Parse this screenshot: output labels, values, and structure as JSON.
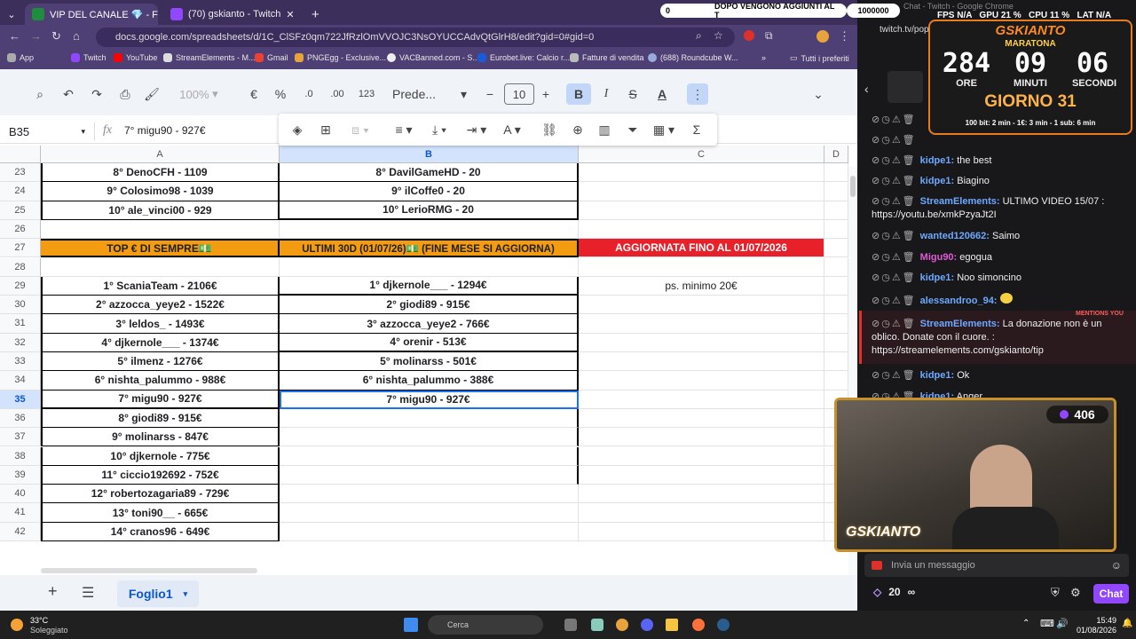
{
  "browser": {
    "tabs": [
      {
        "label": "VIP DEL CANALE 💎 - Fogli Go",
        "active": true,
        "color": "#1e8e3e"
      },
      {
        "label": "(70) gskianto - Twitch",
        "active": false,
        "color": "#9146ff"
      }
    ],
    "new_tab": "+",
    "url": "docs.google.com/spreadsheets/d/1C_ClSFz0qm722JfRzlOmVVOJC3NsOYUCCAdvQtGlrH8/edit?gid=0#gid=0",
    "bookmarks": [
      "App",
      "Twitch",
      "YouTube",
      "StreamElements - M...",
      "Gmail",
      "PNGEgg - Exclusive...",
      "VACBanned.com - S...",
      "Eurobet.live: Calcio r...",
      "Fatture di vendita",
      "(688) Roundcube W..."
    ],
    "bookmarks_overflow": "»",
    "bookmarks_folder": "Tutti i preferiti"
  },
  "sheets": {
    "zoom": "100%",
    "currency": "€",
    "percent": "%",
    "dec_minus": ".0",
    "dec_plus": ".00",
    "format_123": "123",
    "font": "Prede...",
    "font_size": "10",
    "cell_ref": "B35",
    "formula": "7° migu90 - 927€",
    "columns": [
      "A",
      "B",
      "C",
      "D"
    ],
    "rows": [
      {
        "n": "23",
        "a": "8° DenoCFH - 1109",
        "b": "8° DavilGameHD - 20",
        "c": ""
      },
      {
        "n": "24",
        "a": "9° Colosimo98 - 1039",
        "b": "9° ilCoffe0 - 20",
        "c": ""
      },
      {
        "n": "25",
        "a": "10° ale_vinci00 - 929",
        "b": "10° LerioRMG - 20",
        "c": ""
      },
      {
        "n": "26",
        "a": "",
        "b": "",
        "c": ""
      },
      {
        "n": "27",
        "a": "TOP € DI SEMPRE💵",
        "b": "ULTIMI 30D (01/07/26)💵 (FINE MESE SI AGGIORNA)",
        "c": "AGGIORNATA FINO AL  01/07/2026"
      },
      {
        "n": "28",
        "a": "",
        "b": "",
        "c": ""
      },
      {
        "n": "29",
        "a": "1° ScaniaTeam - 2106€",
        "b": "1° djkernole___ - 1294€",
        "c": "ps. minimo 20€"
      },
      {
        "n": "30",
        "a": "2° azzocca_yeye2 - 1522€",
        "b": "2° giodi89 - 915€",
        "c": ""
      },
      {
        "n": "31",
        "a": "3° leldos_ - 1493€",
        "b": "3° azzocca_yeye2 - 766€",
        "c": ""
      },
      {
        "n": "32",
        "a": "4° djkernole___ - 1374€",
        "b": "4° orenir - 513€",
        "c": ""
      },
      {
        "n": "33",
        "a": "5° ilmenz - 1276€",
        "b": "5° molinarss - 501€",
        "c": ""
      },
      {
        "n": "34",
        "a": "6° nishta_palummo - 988€",
        "b": "6° nishta_palummo - 388€",
        "c": ""
      },
      {
        "n": "35",
        "a": "7° migu90 - 927€",
        "b": "7° migu90 - 927€",
        "c": ""
      },
      {
        "n": "36",
        "a": "8° giodi89 - 915€",
        "b": "",
        "c": ""
      },
      {
        "n": "37",
        "a": "9° molinarss - 847€",
        "b": "",
        "c": ""
      },
      {
        "n": "38",
        "a": "10° djkernole - 775€",
        "b": "",
        "c": ""
      },
      {
        "n": "39",
        "a": "11° ciccio192692 - 752€",
        "b": "",
        "c": ""
      },
      {
        "n": "40",
        "a": "12° robertozagaria89 - 729€",
        "b": "",
        "c": ""
      },
      {
        "n": "41",
        "a": "13° toni90__ - 665€",
        "b": "",
        "c": ""
      },
      {
        "n": "42",
        "a": "14° cranos96 - 649€",
        "b": "",
        "c": ""
      }
    ],
    "sheet_tab": "Foglio1",
    "add_sheet": "+",
    "colors": {
      "orange": "#f39c12",
      "red": "#e8202a",
      "selection": "#1a73e8"
    }
  },
  "twitch": {
    "ticker_count": "0",
    "ticker_text": "DOPO VENGONO AGGIUNTI AL T",
    "ticker_total": "1000000",
    "stats": "FPS N/A   GPU 21 %   CPU 11 %   LAT N/A",
    "window_title": "Chat - Twitch - Google Chrome",
    "url": "twitch.tv/popout/gskianto/",
    "marathon": {
      "brand": "GSKIANTO",
      "subtitle": "MARATONA",
      "hours": "284",
      "minutes": "09",
      "seconds": "06",
      "l_hours": "ORE",
      "l_minutes": "MINUTI",
      "l_seconds": "SECONDI",
      "day": "GIORNO 31",
      "rates": "100 bit: 2 min - 1€: 3 min - 1 sub: 6 min"
    },
    "chat": [
      {
        "user": "kidpe1:",
        "msg": "the best",
        "color": "#6fa8ff"
      },
      {
        "user": "kidpe1:",
        "msg": "Biagino",
        "color": "#6fa8ff"
      },
      {
        "user": "StreamElements:",
        "msg": "ULTIMO VIDEO 15/07 : https://youtu.be/xmkPzyaJt2I",
        "color": "#6fa8ff"
      },
      {
        "user": "wanted120662:",
        "msg": "Saimo",
        "color": "#6fa8ff"
      },
      {
        "user": "Migu90:",
        "msg": "egogua",
        "color": "#e05ad6"
      },
      {
        "user": "kidpe1:",
        "msg": "Noo simoncino",
        "color": "#6fa8ff"
      },
      {
        "user": "alessandroo_94:",
        "msg": "",
        "color": "#6fa8ff"
      },
      {
        "user": "StreamElements:",
        "msg": "La donazione non è un oblico. Donate con il cuore. : https://streamelements.com/gskianto/tip",
        "color": "#6fa8ff"
      },
      {
        "user": "kidpe1:",
        "msg": "Ok",
        "color": "#6fa8ff"
      },
      {
        "user": "kidpe1:",
        "msg": "Anger",
        "color": "#6fa8ff"
      }
    ],
    "mentions": "MENTIONS YOU",
    "cam_viewers": "406",
    "cam_brand": "GSKIANTO",
    "input_placeholder": "Invia un messaggio",
    "points": "20",
    "infinity": "∞",
    "chat_button": "Chat"
  },
  "taskbar": {
    "temp": "33°C",
    "weather": "Soleggiato",
    "search": "Cerca",
    "time": "15:49",
    "date": "01/08/2026"
  }
}
